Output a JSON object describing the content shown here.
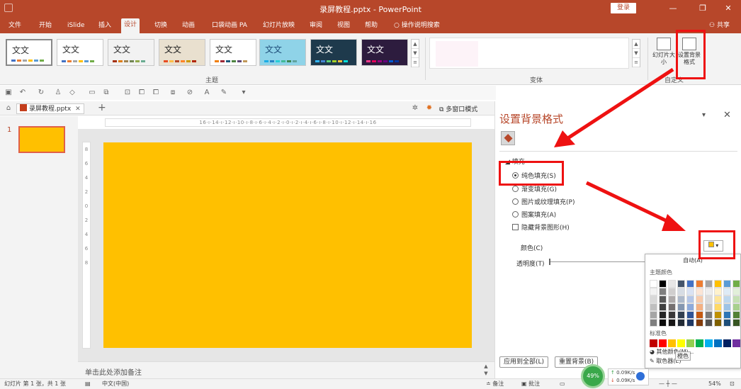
{
  "window": {
    "title": "录屏教程.pptx - PowerPoint",
    "login": "登录",
    "buttons": {
      "min": "—",
      "restore": "❐",
      "close": "✕"
    }
  },
  "tabs": [
    "文件",
    "开始",
    "iSlide",
    "插入",
    "设计",
    "切换",
    "动画",
    "口袋动画 PA",
    "幻灯片放映",
    "审阅",
    "视图",
    "帮助",
    "操作说明搜索"
  ],
  "active_tab": "设计",
  "share": "共享",
  "ribbon": {
    "themes_label": "主题",
    "variants_label": "变体",
    "customize_label": "自定义",
    "theme_text": "文文",
    "slide_size_label": "幻灯片大小",
    "format_bg_label": "设置背景格式",
    "themes": [
      {
        "bg": "#ffffff",
        "text_color": "#333333",
        "bars": [
          "#4472c4",
          "#ed7d31",
          "#a5a5a5",
          "#ffc000",
          "#5b9bd5",
          "#70ad47"
        ]
      },
      {
        "bg": "#ffffff",
        "text_color": "#333333",
        "bars": [
          "#4472c4",
          "#ed7d31",
          "#a5a5a5",
          "#ffc000",
          "#5b9bd5",
          "#70ad47"
        ]
      },
      {
        "bg": "#f2f2f2",
        "text_color": "#333333",
        "bars": [
          "#a53010",
          "#de7e18",
          "#9f8351",
          "#728653",
          "#92aa4c",
          "#6aac91"
        ]
      },
      {
        "bg": "#e9e0cf",
        "text_color": "#222222",
        "bars": [
          "#e84c22",
          "#ffbd47",
          "#b64926",
          "#ff8427",
          "#cc9900",
          "#b22600"
        ]
      },
      {
        "bg": "#ffffff",
        "text_color": "#333333",
        "bars": [
          "#f07f09",
          "#9f2936",
          "#1b587c",
          "#4e8542",
          "#604878",
          "#c19859"
        ]
      },
      {
        "bg": "#8fd3e8",
        "text_color": "#1f4e79",
        "bars": [
          "#1cade4",
          "#2683c6",
          "#27ced7",
          "#42ba97",
          "#3e8853",
          "#62a39f"
        ]
      },
      {
        "bg": "#1e3a4c",
        "text_color": "#ffffff",
        "bars": [
          "#31b6fd",
          "#4584d3",
          "#5bd078",
          "#a5d028",
          "#f5c040",
          "#05e0db"
        ]
      },
      {
        "bg": "#2d1c3e",
        "text_color": "#ffffff",
        "bars": [
          "#ff388c",
          "#e40059",
          "#9c007f",
          "#68007f",
          "#005bd3",
          "#00349e"
        ]
      }
    ]
  },
  "document": {
    "file_tab": "录屏教程.pptx",
    "multi_window": "多窗口模式",
    "slide_number": "1",
    "ruler_h": "16·ı·14·ı·12·ı·10·ı·8·ı·6·ı·4·ı·2·ı·0·ı·2·ı·4·ı·6·ı·8·ı·10·ı·12·ı·14·ı·16",
    "ruler_v": [
      "8",
      "6",
      "4",
      "2",
      "0",
      "2",
      "4",
      "6",
      "8"
    ],
    "notes_placeholder": "单击此处添加备注",
    "slide_color": "#ffc000"
  },
  "pane": {
    "title": "设置背景格式",
    "section": "填充",
    "options": [
      {
        "label": "纯色填充(S)",
        "type": "radio",
        "checked": true
      },
      {
        "label": "渐变填充(G)",
        "type": "radio",
        "checked": false
      },
      {
        "label": "图片或纹理填充(P)",
        "type": "radio",
        "checked": false
      },
      {
        "label": "图案填充(A)",
        "type": "radio",
        "checked": false
      },
      {
        "label": "隐藏背景图形(H)",
        "type": "checkbox",
        "checked": false
      }
    ],
    "color_label": "颜色(C)",
    "transparency_label": "透明度(T)",
    "apply_all": "应用到全部(L)",
    "reset": "重置背景(B)"
  },
  "color_popup": {
    "auto": "自动(A)",
    "theme_colors_label": "主题颜色",
    "standard_colors_label": "标准色",
    "more_colors": "其他颜色(M)...",
    "eyedropper": "取色器(E)",
    "tooltip": "橙色",
    "theme_colors": [
      [
        "#ffffff",
        "#000000",
        "#e7e6e6",
        "#44546a",
        "#4472c4",
        "#ed7d31",
        "#a5a5a5",
        "#ffc000",
        "#5b9bd5",
        "#70ad47"
      ],
      [
        "#f2f2f2",
        "#7f7f7f",
        "#d0cece",
        "#d6dce4",
        "#d9e2f3",
        "#fbe5d5",
        "#ededed",
        "#fff2cc",
        "#deebf6",
        "#e2efd9"
      ],
      [
        "#d8d8d8",
        "#595959",
        "#aeaaaa",
        "#adb9ca",
        "#b4c6e7",
        "#f7cbac",
        "#dbdbdb",
        "#fee599",
        "#bdd7ee",
        "#c5e0b3"
      ],
      [
        "#bfbfbf",
        "#3f3f3f",
        "#757070",
        "#8496b0",
        "#8eaadb",
        "#f4b183",
        "#c9c9c9",
        "#ffd965",
        "#9dc3e6",
        "#a8d08d"
      ],
      [
        "#a5a5a5",
        "#262626",
        "#3a3838",
        "#323f4f",
        "#2f5496",
        "#c55a11",
        "#7b7b7b",
        "#bf9000",
        "#2e75b5",
        "#538135"
      ],
      [
        "#7f7f7f",
        "#0c0c0c",
        "#171616",
        "#222a35",
        "#1f3864",
        "#833c0b",
        "#525252",
        "#7f6000",
        "#1e4e79",
        "#375623"
      ]
    ],
    "standard_colors": [
      "#c00000",
      "#ff0000",
      "#ffc000",
      "#ffff00",
      "#92d050",
      "#00b050",
      "#00b0f0",
      "#0070c0",
      "#002060",
      "#7030a0"
    ]
  },
  "status": {
    "slide_info": "幻灯片 第 1 张，共 1 张",
    "language": "中文(中国)",
    "notes": "备注",
    "comments": "批注",
    "zoom": "54%"
  },
  "network": {
    "percent": "49%",
    "up": "0.09K/s",
    "down": "0.09K/s"
  },
  "colors": {
    "brand": "#b7472a",
    "highlight": "#e11111",
    "slide": "#ffc000"
  }
}
